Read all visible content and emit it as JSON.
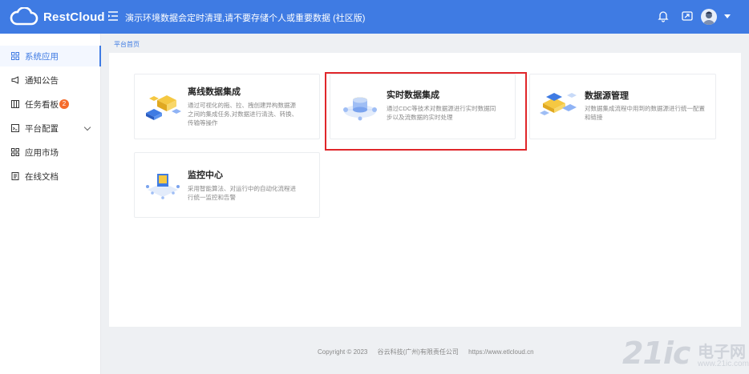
{
  "header": {
    "logo_text": "RestCloud",
    "notice": "演示环境数据会定时清理,请不要存储个人或重要数据 (社区版)",
    "background_color": "#3f7be3"
  },
  "sidebar": {
    "items": [
      {
        "label": "系统应用",
        "icon": "grid-icon",
        "active": true
      },
      {
        "label": "通知公告",
        "icon": "megaphone-icon"
      },
      {
        "label": "任务看板",
        "icon": "board-icon",
        "badge": "2"
      },
      {
        "label": "平台配置",
        "icon": "config-icon",
        "expandable": true
      },
      {
        "label": "应用市场",
        "icon": "grid-icon"
      },
      {
        "label": "在线文档",
        "icon": "document-icon"
      }
    ]
  },
  "breadcrumb": "平台首页",
  "cards": [
    {
      "title": "离线数据集成",
      "description": "通过可视化的拖、拉、拽创建异构数据源之间的集成任务,对数据进行清洗、转换、传输等操作"
    },
    {
      "title": "实时数据集成",
      "description": "通过CDC等技术对数据源进行实时数据同步以及流数据的实时处理"
    },
    {
      "title": "数据源管理",
      "description": "对数据集成流程中用到的数据源进行统一配置和链接"
    },
    {
      "title": "监控中心",
      "description": "采用智能算法、对运行中的自动化流程进行统一监控和告警"
    }
  ],
  "footer": {
    "copyright": "Copyright © 2023",
    "company": "谷云科技(广州)有限责任公司",
    "url": "https://www.etlcloud.cn"
  },
  "watermark": {
    "big": "21ic",
    "cn": "电子网",
    "url": "www.21ic.com"
  },
  "colors": {
    "accent": "#3f7be3",
    "highlight": "#e0262a",
    "badge": "#f56c2c"
  }
}
